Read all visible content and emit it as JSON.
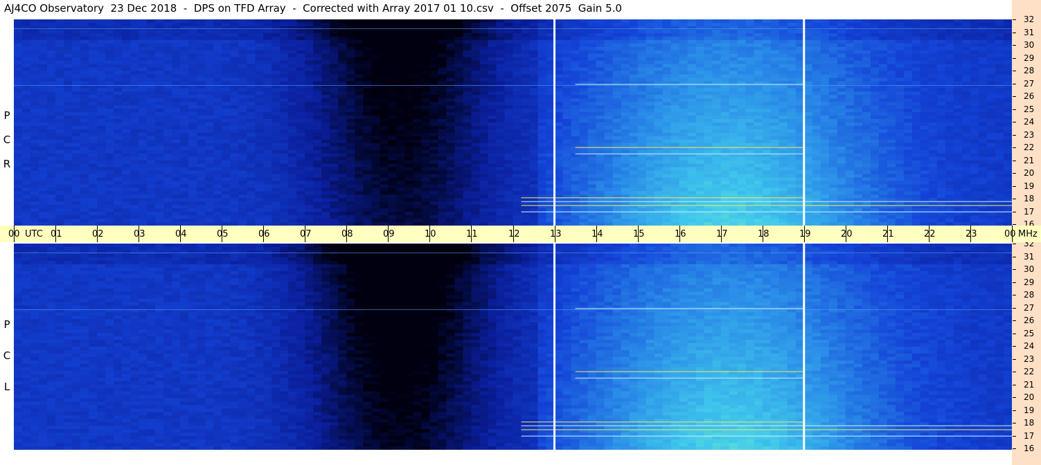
{
  "title": "AJ4CO Observatory  23 Dec 2018  -  DPS on TFD Array  -  Corrected with Array 2017 01 10.csv  -  Offset 2075  Gain 5.0",
  "panels": [
    {
      "pol_letters": [
        "R",
        "C",
        "P"
      ]
    },
    {
      "pol_letters": [
        "L",
        "C",
        "P"
      ]
    }
  ],
  "utc_ticks": [
    "00",
    "UTC",
    "01",
    "02",
    "03",
    "04",
    "05",
    "06",
    "07",
    "08",
    "09",
    "10",
    "11",
    "12",
    "13",
    "14",
    "15",
    "16",
    "17",
    "18",
    "19",
    "20",
    "21",
    "22",
    "23",
    "00",
    "MHz"
  ],
  "chart_data": {
    "type": "heatmap",
    "title": "AJ4CO Observatory  23 Dec 2018  -  DPS on TFD Array  -  Corrected with Array 2017 01 10.csv  -  Offset 2075  Gain 5.0",
    "x_label": "UTC",
    "x_range": [
      0,
      24
    ],
    "x_ticks": [
      "00",
      "01",
      "02",
      "03",
      "04",
      "05",
      "06",
      "07",
      "08",
      "09",
      "10",
      "11",
      "12",
      "13",
      "14",
      "15",
      "16",
      "17",
      "18",
      "19",
      "20",
      "21",
      "22",
      "23",
      "00"
    ],
    "y_label": "MHz",
    "y_range": [
      16,
      32
    ],
    "y_ticks": [
      32,
      31,
      30,
      29,
      28,
      27,
      26,
      25,
      24,
      23,
      22,
      21,
      20,
      19,
      18,
      17,
      16
    ],
    "panels": [
      "RCP",
      "LCP"
    ],
    "data_gaps_utc": [
      13,
      19
    ],
    "colormap": [
      "#000010",
      "#0a1e9a",
      "#1444d8",
      "#2a8ce8",
      "#40c8ec",
      "#7ef0c0",
      "#e8f040"
    ],
    "legend": "none"
  }
}
